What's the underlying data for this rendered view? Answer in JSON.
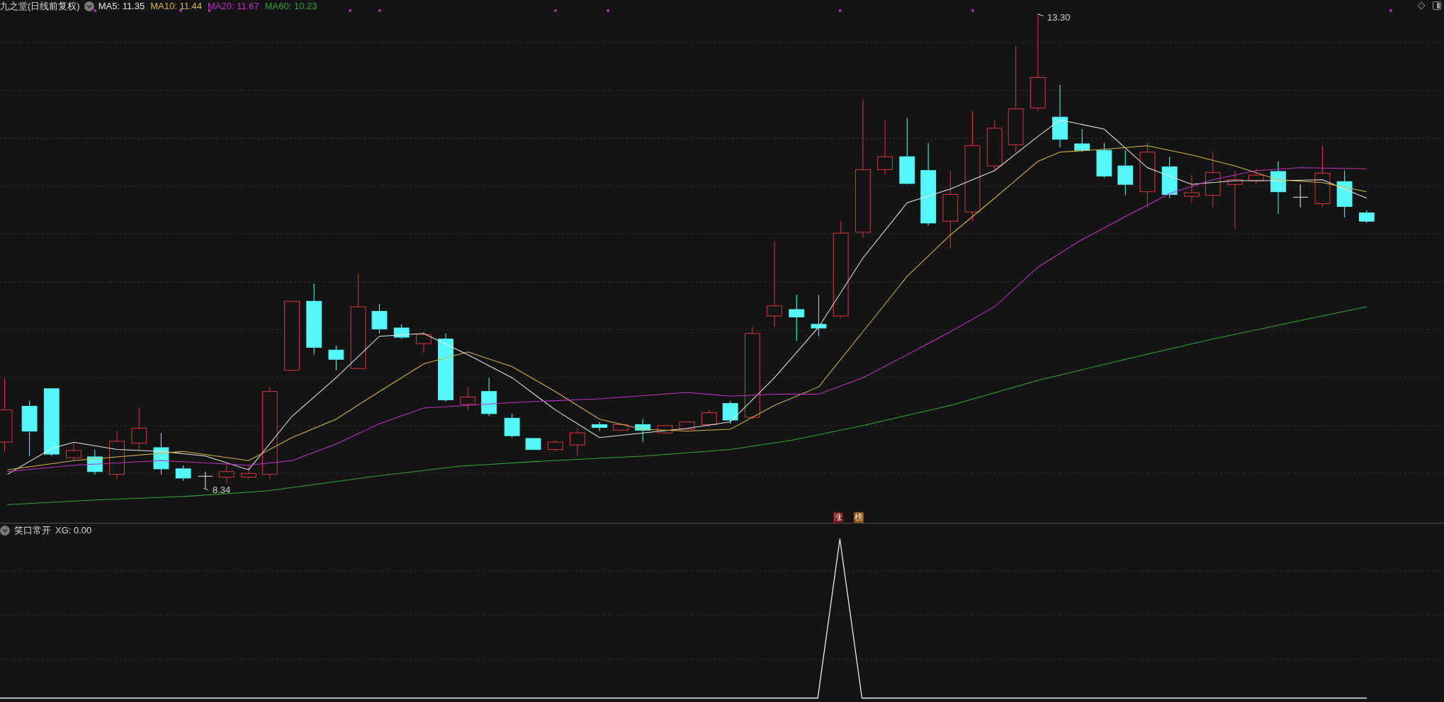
{
  "main_panel": {
    "title": "九之堂(日线前复权)",
    "moving_averages": [
      {
        "label": "MA5: 11.35",
        "color": "#e6e6e6"
      },
      {
        "label": "MA10: 11.44",
        "color": "#d6b640"
      },
      {
        "label": "MA20: 11.67",
        "color": "#c030c8"
      },
      {
        "label": "MA60: 10.23",
        "color": "#2ea82e"
      }
    ],
    "high_label": "13.30",
    "low_label": "8.34",
    "signal_badges": [
      {
        "text": "涨",
        "color": "#6e0d12"
      },
      {
        "text": "榜",
        "color": "#8a5414"
      }
    ]
  },
  "indicator_panel": {
    "title": "笑口常开",
    "reading": "XG: 0.00"
  }
}
